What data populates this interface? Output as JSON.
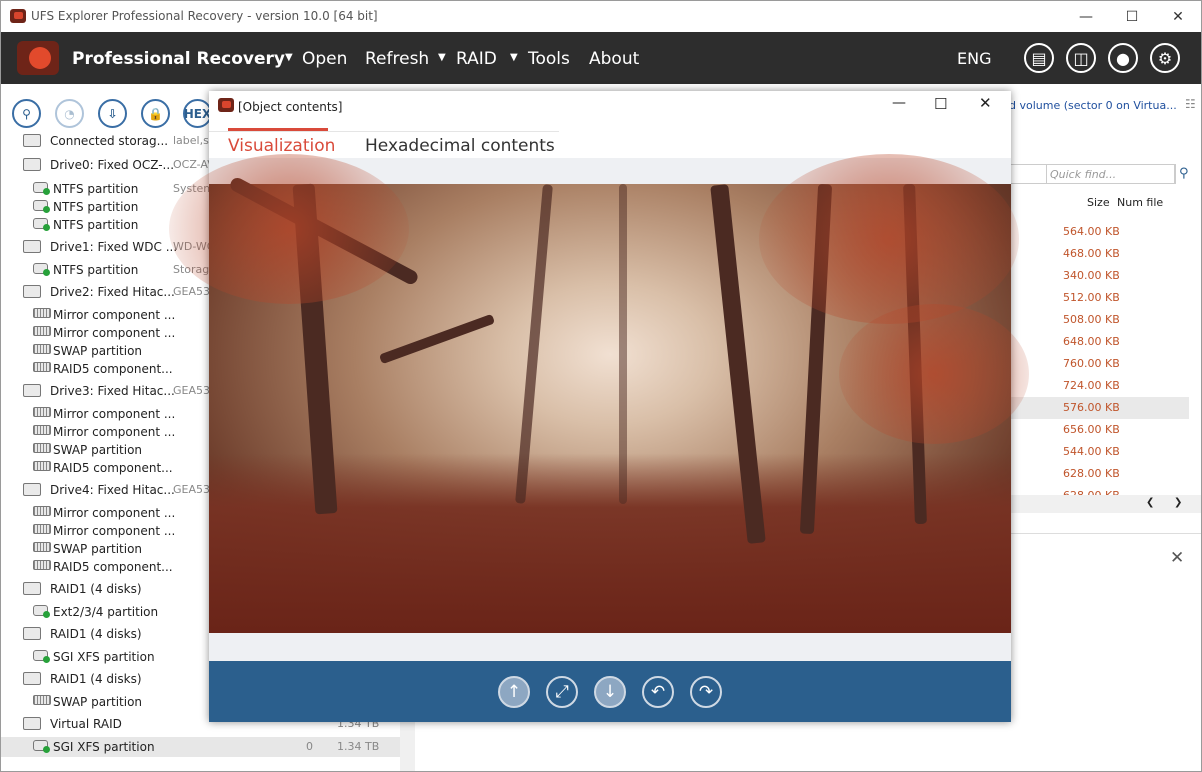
{
  "window": {
    "title": "UFS Explorer Professional Recovery - version 10.0 [64 bit]"
  },
  "menu": {
    "brand": "Professional Recovery",
    "open": "Open",
    "refresh": "Refresh",
    "raid": "RAID",
    "tools": "Tools",
    "about": "About",
    "language": "ENG"
  },
  "toolbar": {
    "hex_label": "HEX"
  },
  "left_tree": [
    {
      "label": "Connected storag...",
      "sub": "label,s"
    },
    {
      "label": "Drive0: Fixed OCZ-...",
      "sub": "OCZ-AV"
    },
    {
      "label": "NTFS partition",
      "sub": "System"
    },
    {
      "label": "NTFS partition",
      "sub": ""
    },
    {
      "label": "NTFS partition",
      "sub": ""
    },
    {
      "label": "Drive1: Fixed WDC ...",
      "sub": "WD-WC"
    },
    {
      "label": "NTFS partition",
      "sub": "Storage"
    },
    {
      "label": "Drive2: Fixed Hitac...",
      "sub": "GEA534"
    },
    {
      "label": "Mirror component ...",
      "sub": ""
    },
    {
      "label": "Mirror component ...",
      "sub": ""
    },
    {
      "label": "SWAP partition",
      "sub": ""
    },
    {
      "label": "RAID5 component...",
      "sub": ""
    },
    {
      "label": "Drive3: Fixed Hitac...",
      "sub": "GEA534"
    },
    {
      "label": "Mirror component ...",
      "sub": ""
    },
    {
      "label": "Mirror component ...",
      "sub": ""
    },
    {
      "label": "SWAP partition",
      "sub": ""
    },
    {
      "label": "RAID5 component...",
      "sub": ""
    },
    {
      "label": "Drive4: Fixed Hitac...",
      "sub": "GEA534"
    },
    {
      "label": "Mirror component ...",
      "sub": ""
    },
    {
      "label": "Mirror component ...",
      "sub": ""
    },
    {
      "label": "SWAP partition",
      "sub": ""
    },
    {
      "label": "RAID5 component...",
      "sub": ""
    },
    {
      "label": "RAID1 (4 disks)",
      "sub": ""
    },
    {
      "label": "Ext2/3/4 partition",
      "sub": ""
    },
    {
      "label": "RAID1 (4 disks)",
      "sub": ""
    },
    {
      "label": "SGI XFS partition",
      "sub": ""
    },
    {
      "label": "RAID1 (4 disks)",
      "sub": ""
    },
    {
      "label": "SWAP partition",
      "sub": ""
    },
    {
      "label": "Virtual RAID",
      "sub": "1.34 TB"
    },
    {
      "label": "SGI XFS partition",
      "sub": "0",
      "size": "1.34 TB"
    }
  ],
  "right_pane": {
    "path": "d volume (sector 0 on Virtua...",
    "search_placeholder": "Quick find...",
    "col_size": "Size",
    "col_files": "Num file",
    "sizes": [
      "564.00 KB",
      "468.00 KB",
      "340.00 KB",
      "512.00 KB",
      "508.00 KB",
      "648.00 KB",
      "760.00 KB",
      "724.00 KB",
      "576.00 KB",
      "656.00 KB",
      "544.00 KB",
      "628.00 KB",
      "628.00 KB"
    ]
  },
  "dialog": {
    "title": "[Object contents]",
    "tab_visualization": "Visualization",
    "tab_hex": "Hexadecimal contents"
  },
  "icons": {
    "nav": [
      "arrow-up-icon",
      "fit-screen-icon",
      "arrow-down-icon",
      "rotate-left-icon",
      "rotate-right-icon"
    ]
  }
}
